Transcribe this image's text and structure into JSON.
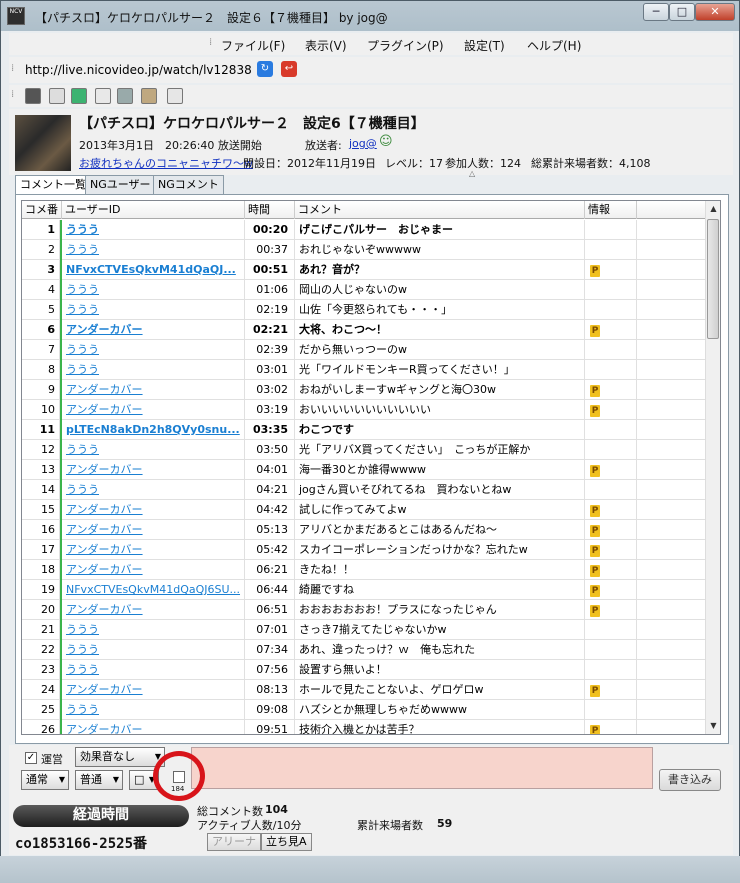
{
  "window": {
    "title": "【パチスロ】ケロケロパルサー２　設定６【７機種目】 by jog@",
    "icon_text": "NCV",
    "min": "─",
    "max": "□",
    "close": "✕"
  },
  "menu": [
    "ファイル(F)",
    "表示(V)",
    "プラグイン(P)",
    "設定(T)",
    "ヘルプ(H)"
  ],
  "url": "http://live.nicovideo.jp/watch/lv12838",
  "stream": {
    "title": "【パチスロ】ケロケロパルサー２　設定6【７機種目】",
    "start_label": "2013年3月1日　20:26:40 放送開始",
    "broadcaster_label": "放送者:",
    "broadcaster": "jog@",
    "community": "お疲れちゃんのコニャニャチワ〜w",
    "opened": "開設日：2012年11月19日",
    "level": "レベル：17",
    "participants": "参加人数：124",
    "total_visitors": "総累計来場者数：4,108"
  },
  "tabs": [
    "コメント一覧",
    "NGユーザー",
    "NGコメント"
  ],
  "columns": [
    "コメ番",
    "ユーザーID",
    "時間",
    "コメント",
    "情報"
  ],
  "rows": [
    {
      "no": "1",
      "uid": "ううう",
      "time": "00:20",
      "comment": "げこげこパルサー　おじゃまー",
      "p": false,
      "bold": true
    },
    {
      "no": "2",
      "uid": "ううう",
      "time": "00:37",
      "comment": "おれじゃないぞwwwww",
      "p": false,
      "bold": false
    },
    {
      "no": "3",
      "uid": "NFvxCTVEsQkvM41dQaQJ...",
      "time": "00:51",
      "comment": "あれ？音が？",
      "p": true,
      "bold": true
    },
    {
      "no": "4",
      "uid": "ううう",
      "time": "01:06",
      "comment": "岡山の人じゃないのw",
      "p": false,
      "bold": false
    },
    {
      "no": "5",
      "uid": "ううう",
      "time": "02:19",
      "comment": "山佐「今更怒られても・・・」",
      "p": false,
      "bold": false
    },
    {
      "no": "6",
      "uid": "アンダーカバー",
      "time": "02:21",
      "comment": "大将、わこつ〜！",
      "p": true,
      "bold": true
    },
    {
      "no": "7",
      "uid": "ううう",
      "time": "02:39",
      "comment": "だから無いっつーのw",
      "p": false,
      "bold": false
    },
    {
      "no": "8",
      "uid": "ううう",
      "time": "03:01",
      "comment": "光「ワイルドモンキーR買ってください！」",
      "p": false,
      "bold": false
    },
    {
      "no": "9",
      "uid": "アンダーカバー",
      "time": "03:02",
      "comment": "おねがいしまーすwギャングと海〇30w",
      "p": true,
      "bold": false
    },
    {
      "no": "10",
      "uid": "アンダーカバー",
      "time": "03:19",
      "comment": "おいいいいいいいいいいい",
      "p": true,
      "bold": false
    },
    {
      "no": "11",
      "uid": "pLTEcN8akDn2h8QVy0snu...",
      "time": "03:35",
      "comment": "わこつです",
      "p": false,
      "bold": true
    },
    {
      "no": "12",
      "uid": "ううう",
      "time": "03:50",
      "comment": "光「アリバX買ってください」　こっちが正解か",
      "p": false,
      "bold": false
    },
    {
      "no": "13",
      "uid": "アンダーカバー",
      "time": "04:01",
      "comment": "海一番30とか誰得wwww",
      "p": true,
      "bold": false
    },
    {
      "no": "14",
      "uid": "ううう",
      "time": "04:21",
      "comment": "jogさん買いそびれてるね　買わないとねw",
      "p": false,
      "bold": false
    },
    {
      "no": "15",
      "uid": "アンダーカバー",
      "time": "04:42",
      "comment": "試しに作ってみてよw",
      "p": true,
      "bold": false
    },
    {
      "no": "16",
      "uid": "アンダーカバー",
      "time": "05:13",
      "comment": "アリバとかまだあるとこはあるんだね〜",
      "p": true,
      "bold": false
    },
    {
      "no": "17",
      "uid": "アンダーカバー",
      "time": "05:42",
      "comment": "スカイコーポレーションだっけかな？忘れたw",
      "p": true,
      "bold": false
    },
    {
      "no": "18",
      "uid": "アンダーカバー",
      "time": "06:21",
      "comment": "きたね！！",
      "p": true,
      "bold": false
    },
    {
      "no": "19",
      "uid": "NFvxCTVEsQkvM41dQaQJ6SU...",
      "time": "06:44",
      "comment": "綺麗ですね",
      "p": true,
      "bold": false
    },
    {
      "no": "20",
      "uid": "アンダーカバー",
      "time": "06:51",
      "comment": "おおおおおおお！プラスになったじゃん",
      "p": true,
      "bold": false
    },
    {
      "no": "21",
      "uid": "ううう",
      "time": "07:01",
      "comment": "さっき7揃えてたじゃないかw",
      "p": false,
      "bold": false
    },
    {
      "no": "22",
      "uid": "ううう",
      "time": "07:34",
      "comment": "あれ、違ったっけ？ｗ　俺も忘れた",
      "p": false,
      "bold": false
    },
    {
      "no": "23",
      "uid": "ううう",
      "time": "07:56",
      "comment": "設置すら無いよ！",
      "p": false,
      "bold": false
    },
    {
      "no": "24",
      "uid": "アンダーカバー",
      "time": "08:13",
      "comment": "ホールで見たことないよ、ゲロゲロw",
      "p": true,
      "bold": false
    },
    {
      "no": "25",
      "uid": "ううう",
      "time": "09:08",
      "comment": "ハズシとか無理しちゃだめwwww",
      "p": false,
      "bold": false
    },
    {
      "no": "26",
      "uid": "アンダーカバー",
      "time": "09:51",
      "comment": "技術介入機とかは苦手？",
      "p": true,
      "bold": false
    }
  ],
  "p_badge": "P",
  "controls": {
    "unei_check": "✓",
    "unei": "運営",
    "sound": "効果音なし",
    "mode1": "通常",
    "mode2": "普通",
    "color": "□",
    "counter": "184",
    "write": "書き込み"
  },
  "status": {
    "elapsed": "経過時間",
    "community_id": "co1853166-2525番",
    "total_comments_label": "総コメント数",
    "total_comments": "104",
    "active_label": "アクティブ人数/10分",
    "visitors_label": "累計来場者数",
    "visitors": "59",
    "arena": "アリーナ",
    "standing": "立ち見A"
  }
}
